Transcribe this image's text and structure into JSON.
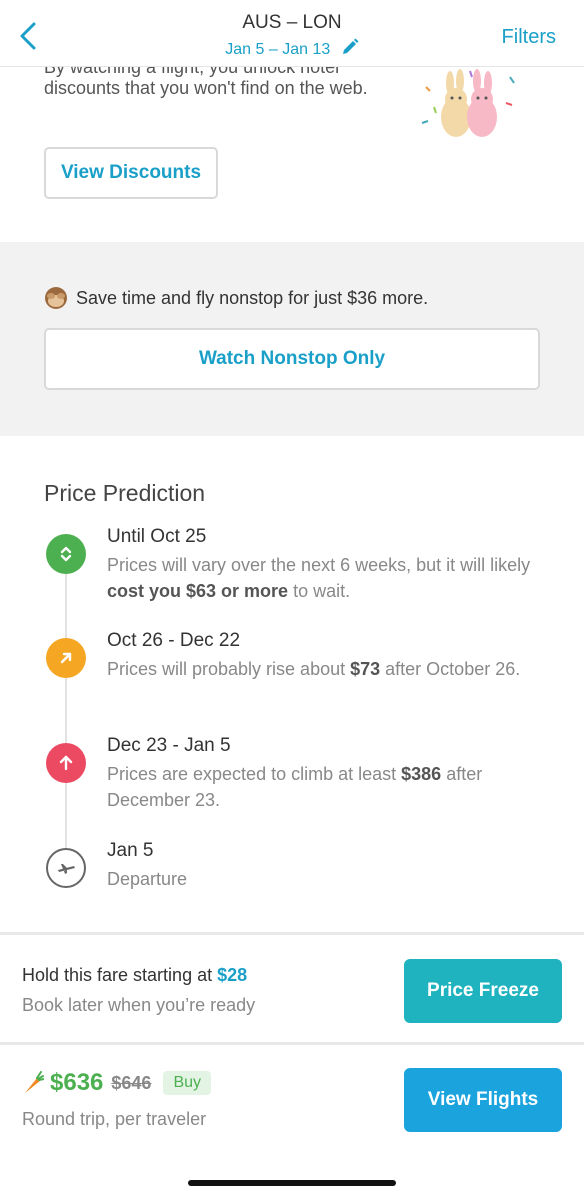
{
  "header": {
    "route": "AUS – LON",
    "dates": "Jan 5 – Jan 13",
    "filters_label": "Filters"
  },
  "discount": {
    "cut_text": "By watching a flight, you unlock hotel",
    "description": "discounts that you won't find on the web.",
    "button_label": "View Discounts"
  },
  "nonstop": {
    "message": "Save time and fly nonstop for just $36 more.",
    "button_label": "Watch Nonstop Only"
  },
  "prediction": {
    "title": "Price Prediction",
    "steps": [
      {
        "head": "Until Oct 25",
        "pre": "Prices will vary over the next 6 weeks, but it will likely ",
        "bold": "cost you $63 or more",
        "post": " to wait.",
        "color": "#4cb050",
        "icon": "double-chevron-icon"
      },
      {
        "head": "Oct 26 - Dec 22",
        "pre": "Prices will probably rise about ",
        "bold": "$73",
        "post": " after October 26.",
        "color": "#f5a623",
        "icon": "arrow-up-right-icon"
      },
      {
        "head": "Dec 23 - Jan 5",
        "pre": "Prices are expected to climb at least ",
        "bold": "$386",
        "post": " after December 23.",
        "color": "#ec4a63",
        "icon": "arrow-up-icon"
      },
      {
        "head": "Jan 5",
        "pre": "Departure",
        "bold": "",
        "post": "",
        "color": "#666666",
        "icon": "plane-icon"
      }
    ]
  },
  "freeze": {
    "line1_prefix": "Hold this fare starting at ",
    "line1_amount": "$28",
    "line2": "Book later when you’re ready",
    "button_label": "Price Freeze"
  },
  "buy": {
    "price": "$636",
    "old_price": "$646",
    "badge": "Buy",
    "subtitle": "Round trip, per traveler",
    "button_label": "View Flights"
  }
}
